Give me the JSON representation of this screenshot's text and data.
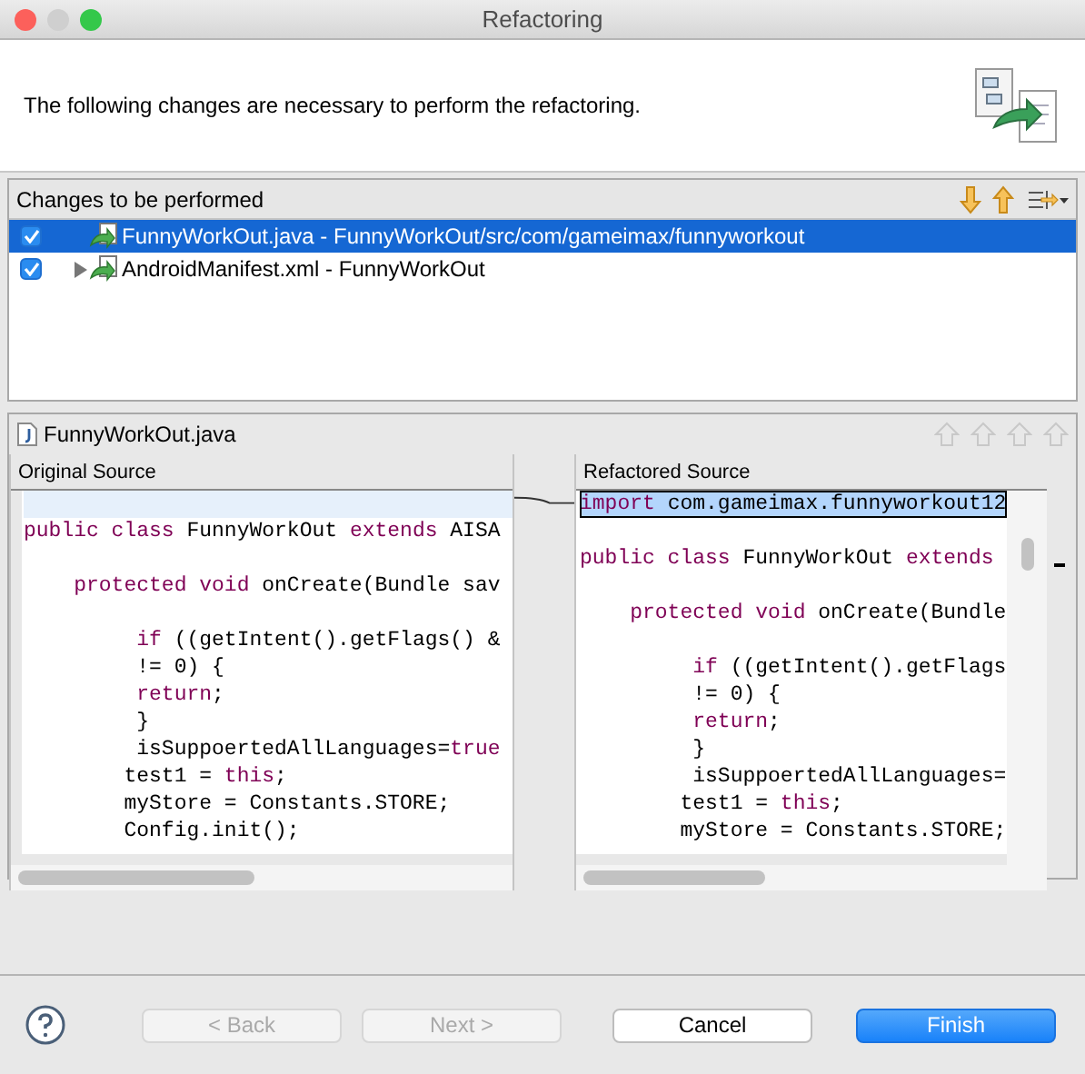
{
  "window": {
    "title": "Refactoring"
  },
  "header": {
    "message": "The following changes are necessary to perform the refactoring."
  },
  "changes": {
    "title": "Changes to be performed",
    "items": [
      {
        "label": "FunnyWorkOut.java - FunnyWorkOut/src/com/gameimax/funnyworkout",
        "checked": true,
        "selected": true
      },
      {
        "label": "AndroidManifest.xml - FunnyWorkOut",
        "checked": true,
        "selected": false,
        "expanded": false
      }
    ]
  },
  "compare": {
    "file": "FunnyWorkOut.java",
    "panes": [
      {
        "title": "Original Source",
        "lines": [
          {
            "highlighted": true
          },
          {
            "segments": [
              {
                "text": "public class ",
                "kind": "keyword"
              },
              {
                "text": "FunnyWorkOut ",
                "kind": "plain"
              },
              {
                "text": "extends ",
                "kind": "keyword"
              },
              {
                "text": "AISA",
                "kind": "plain"
              }
            ]
          },
          {
            "kind": "blank"
          },
          {
            "segments": [
              {
                "text": "    protected void ",
                "kind": "keyword"
              },
              {
                "text": "onCreate(Bundle sav",
                "kind": "plain"
              }
            ]
          },
          {
            "kind": "blank"
          },
          {
            "segments": [
              {
                "text": "         if ",
                "kind": "keyword"
              },
              {
                "text": "((getIntent().getFlags() &",
                "kind": "plain"
              }
            ]
          },
          {
            "segments": [
              {
                "text": "         != 0) {",
                "kind": "plain"
              }
            ]
          },
          {
            "segments": [
              {
                "text": "         return",
                "kind": "keyword"
              },
              {
                "text": ";",
                "kind": "plain"
              }
            ]
          },
          {
            "segments": [
              {
                "text": "         }",
                "kind": "plain"
              }
            ]
          },
          {
            "segments": [
              {
                "text": "         isSuppoertedAllLanguages=",
                "kind": "plain"
              },
              {
                "text": "true",
                "kind": "keyword"
              }
            ]
          },
          {
            "segments": [
              {
                "text": "        test1 = ",
                "kind": "plain"
              },
              {
                "text": "this",
                "kind": "keyword"
              },
              {
                "text": ";",
                "kind": "plain"
              }
            ]
          },
          {
            "segments": [
              {
                "text": "        myStore = Constants.STORE;",
                "kind": "plain"
              }
            ]
          },
          {
            "segments": [
              {
                "text": "        Config.init();",
                "kind": "plain"
              }
            ]
          }
        ]
      },
      {
        "title": "Refactored Source",
        "lines": [
          {
            "highlighted": true,
            "segments": [
              {
                "text": "import ",
                "kind": "keyword"
              },
              {
                "text": "com.gameimax.funnyworkout12",
                "kind": "plain"
              }
            ]
          },
          {
            "kind": "blank"
          },
          {
            "segments": [
              {
                "text": "public class ",
                "kind": "keyword"
              },
              {
                "text": "FunnyWorkOut ",
                "kind": "plain"
              },
              {
                "text": "extends",
                "kind": "keyword"
              }
            ]
          },
          {
            "kind": "blank"
          },
          {
            "segments": [
              {
                "text": "    protected void ",
                "kind": "keyword"
              },
              {
                "text": "onCreate(Bundle",
                "kind": "plain"
              }
            ]
          },
          {
            "kind": "blank"
          },
          {
            "segments": [
              {
                "text": "         if ",
                "kind": "keyword"
              },
              {
                "text": "((getIntent().getFlags",
                "kind": "plain"
              }
            ]
          },
          {
            "segments": [
              {
                "text": "         != 0) {",
                "kind": "plain"
              }
            ]
          },
          {
            "segments": [
              {
                "text": "         return",
                "kind": "keyword"
              },
              {
                "text": ";",
                "kind": "plain"
              }
            ]
          },
          {
            "segments": [
              {
                "text": "         }",
                "kind": "plain"
              }
            ]
          },
          {
            "segments": [
              {
                "text": "         isSuppoertedAllLanguages=",
                "kind": "plain"
              }
            ]
          },
          {
            "segments": [
              {
                "text": "        test1 = ",
                "kind": "plain"
              },
              {
                "text": "this",
                "kind": "keyword"
              },
              {
                "text": ";",
                "kind": "plain"
              }
            ]
          },
          {
            "segments": [
              {
                "text": "        myStore = Constants.STORE;",
                "kind": "plain"
              }
            ]
          }
        ]
      }
    ]
  },
  "buttons": [
    {
      "label": "< Back",
      "disabled": true,
      "default": false
    },
    {
      "label": "Next >",
      "disabled": true,
      "default": false
    },
    {
      "label": "Cancel",
      "disabled": false,
      "default": false
    },
    {
      "label": "Finish",
      "disabled": false,
      "default": true
    }
  ]
}
